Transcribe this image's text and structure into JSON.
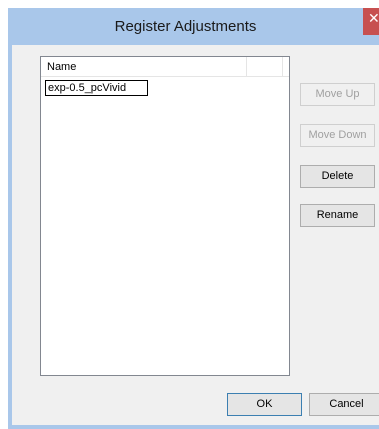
{
  "window": {
    "title": "Register Adjustments",
    "close_glyph": "✕"
  },
  "list": {
    "columns": [
      "Name",
      ""
    ],
    "editing_value": "exp-0.5_pcVivid"
  },
  "buttons": {
    "move_up": "Move Up",
    "move_down": "Move Down",
    "delete": "Delete",
    "rename": "Rename",
    "ok": "OK",
    "cancel": "Cancel"
  },
  "colors": {
    "titlebar": "#a9c7ea",
    "close": "#c75050"
  }
}
